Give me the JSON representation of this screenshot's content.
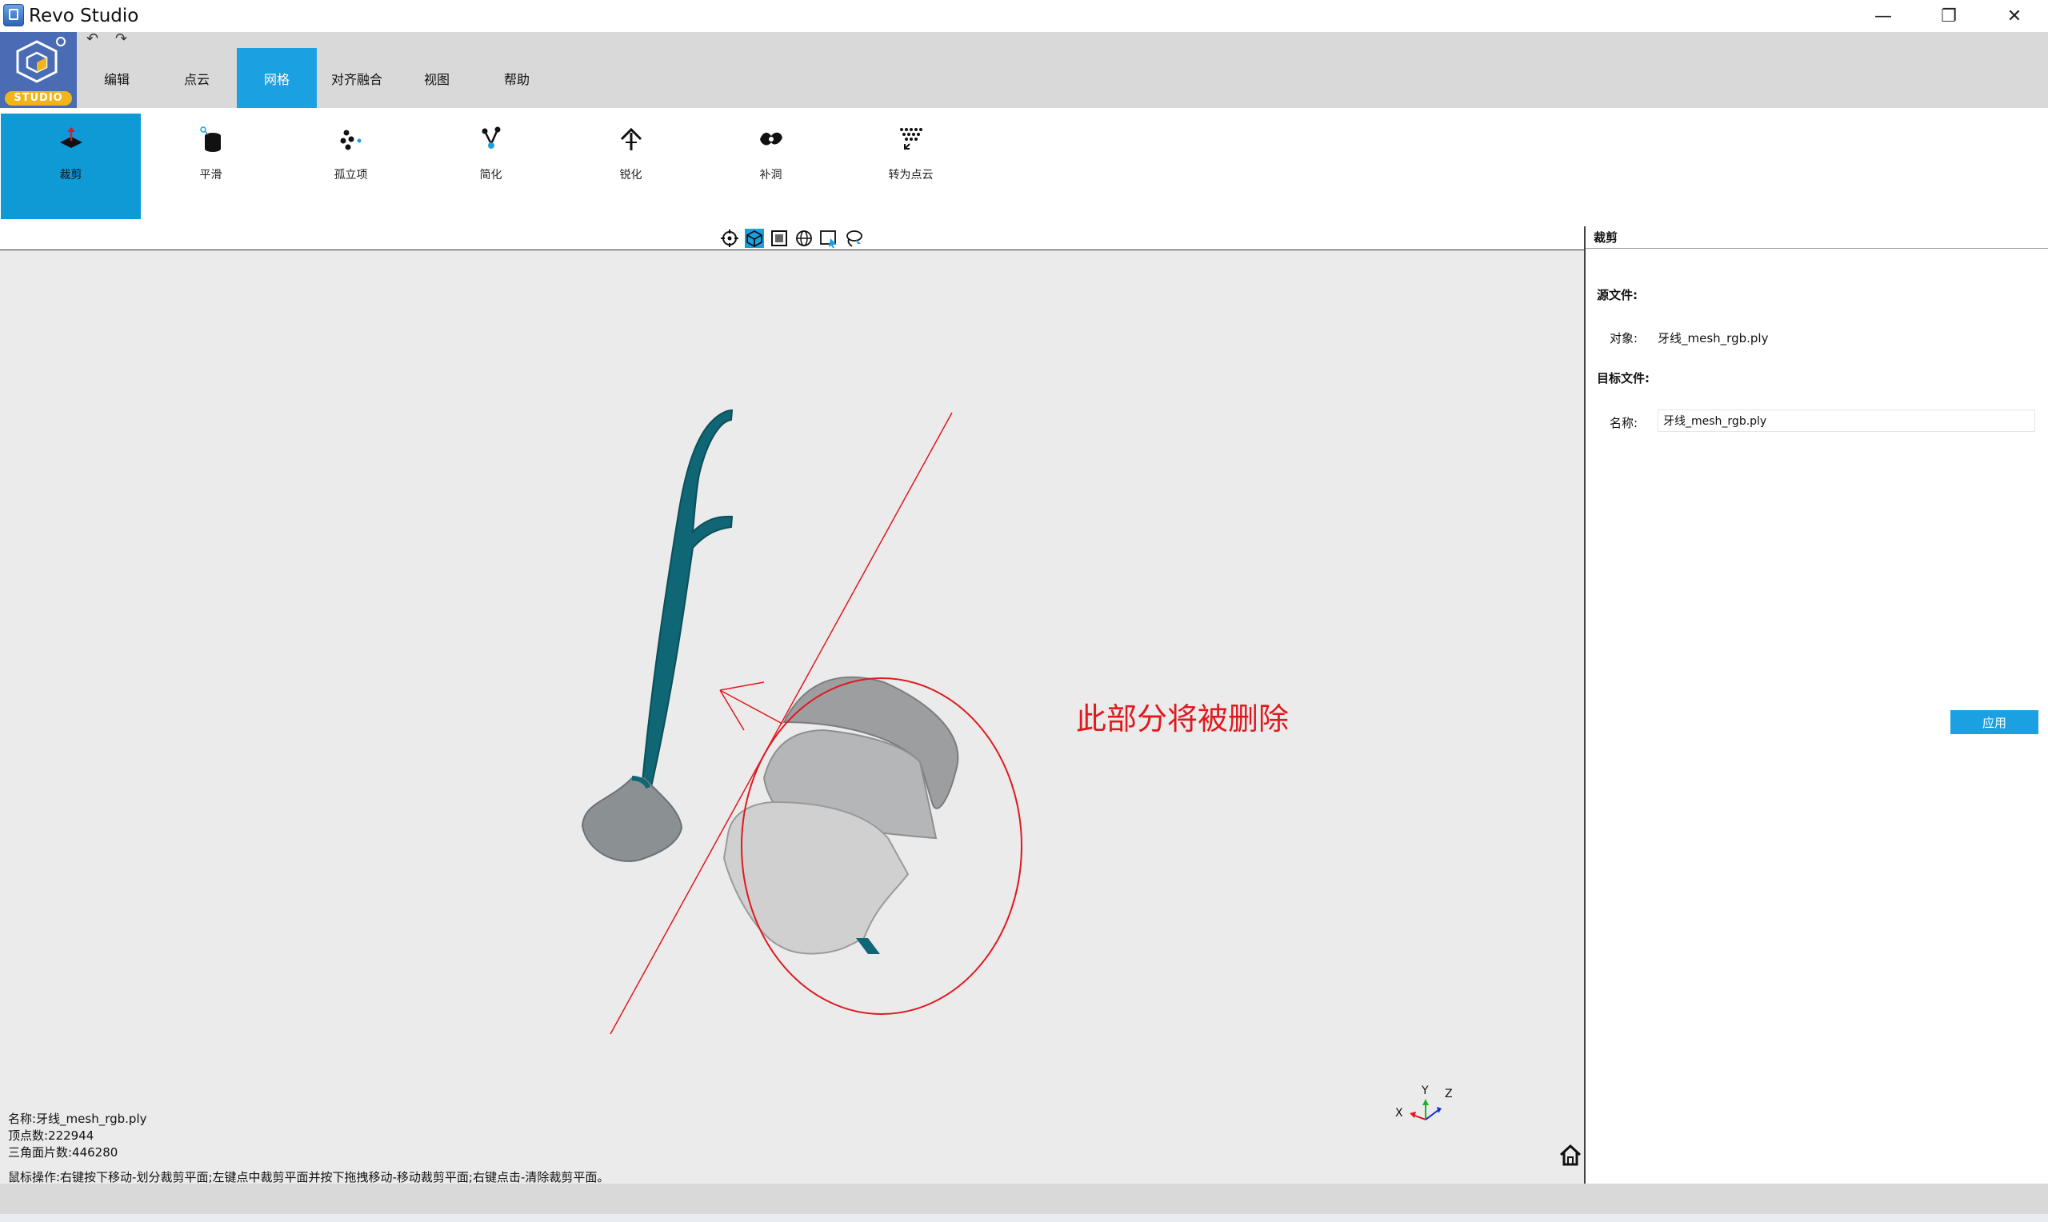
{
  "window": {
    "title": "Revo Studio",
    "minimize_glyph": "—",
    "maximize_glyph": "❐",
    "close_glyph": "✕"
  },
  "logo": {
    "label": "STUDIO"
  },
  "quick_access": {
    "undo_glyph": "↶",
    "redo_glyph": "↷"
  },
  "menu": {
    "tabs": [
      {
        "label": "编辑",
        "active": false
      },
      {
        "label": "点云",
        "active": false
      },
      {
        "label": "网格",
        "active": true
      },
      {
        "label": "对齐融合",
        "active": false
      },
      {
        "label": "视图",
        "active": false
      },
      {
        "label": "帮助",
        "active": false
      }
    ]
  },
  "ribbon": {
    "buttons": [
      {
        "label": "裁剪",
        "icon": "crop-plane-icon",
        "active": true
      },
      {
        "label": "平滑",
        "icon": "smooth-icon",
        "active": false
      },
      {
        "label": "孤立项",
        "icon": "isolated-points-icon",
        "active": false
      },
      {
        "label": "简化",
        "icon": "simplify-icon",
        "active": false
      },
      {
        "label": "锐化",
        "icon": "sharpen-icon",
        "active": false
      },
      {
        "label": "补洞",
        "icon": "fill-hole-icon",
        "active": false
      },
      {
        "label": "转为点云",
        "icon": "to-point-cloud-icon",
        "active": false
      }
    ]
  },
  "view_toolbar": {
    "tools": [
      {
        "icon": "target-icon",
        "active": false
      },
      {
        "icon": "cube-view-icon",
        "active": true
      },
      {
        "icon": "frame-icon",
        "active": false
      },
      {
        "icon": "globe-icon",
        "active": false
      },
      {
        "icon": "select-rect-icon",
        "active": false
      },
      {
        "icon": "lasso-icon",
        "active": false
      }
    ]
  },
  "panel": {
    "title": "裁剪",
    "source_heading": "源文件:",
    "object_label": "对象:",
    "object_value": "牙线_mesh_rgb.ply",
    "target_heading": "目标文件:",
    "name_label": "名称:",
    "name_value": "牙线_mesh_rgb.ply",
    "apply_label": "应用"
  },
  "viewport": {
    "annotation": "此部分将被删除",
    "annotation_color": "#e0191f",
    "model_color": "#0f6674",
    "axis_labels": {
      "x": "X",
      "y": "Y",
      "z": "Z"
    }
  },
  "info": {
    "name": "名称:牙线_mesh_rgb.ply",
    "vertices": "顶点数:222944",
    "triangles": "三角面片数:446280",
    "mouse_ops": "鼠标操作:右键按下移动-划分裁剪平面;左键点中裁剪平面并按下拖拽移动-移动裁剪平面;右键点击-清除裁剪平面。"
  },
  "colors": {
    "accent": "#1ba1e2",
    "menubar": "#d9d9d9",
    "logo_bg": "#4a6cb5",
    "logo_badge": "#f1b51a"
  }
}
